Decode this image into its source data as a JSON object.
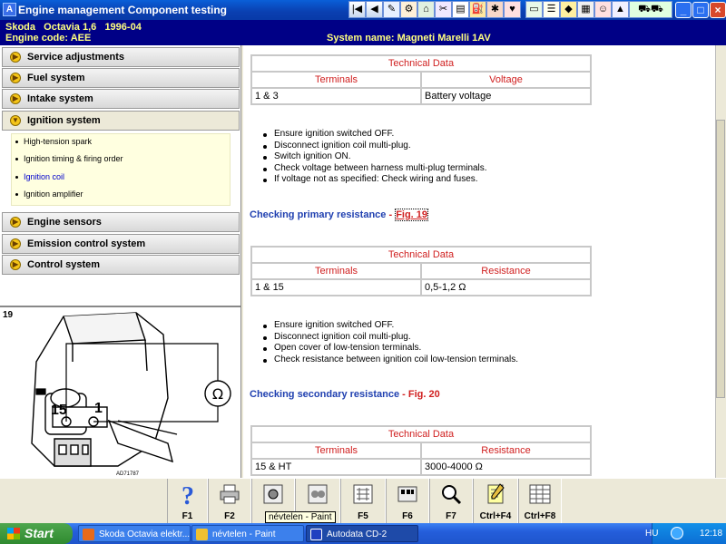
{
  "window": {
    "title": "Engine management Component testing",
    "app_icon_glyph": "A",
    "toolbar_icons": [
      "first-page-icon",
      "previous-icon",
      "bookmark-icon",
      "search-icon",
      "home-icon",
      "tools-icon",
      "manual-icon",
      "fuel-icon",
      "settings-icon",
      "print-icon",
      "warning-icon",
      "help-icon",
      "vehicle-icon",
      "document-icon",
      "user-icon",
      "car-icon"
    ],
    "controls": {
      "minimize": "_",
      "maximize": "□",
      "close": "×"
    }
  },
  "header": {
    "vehicle": "Skoda   Octavia 1,6   1996-04",
    "engine_code": "Engine code: AEE",
    "system_name": "System name: Magneti Marelli 1AV"
  },
  "menu": {
    "items": [
      {
        "label": "Service adjustments"
      },
      {
        "label": "Fuel system"
      },
      {
        "label": "Intake system"
      },
      {
        "label": "Ignition system"
      },
      {
        "label": "Engine sensors"
      },
      {
        "label": "Emission control system"
      },
      {
        "label": "Control system"
      }
    ],
    "subitems": [
      {
        "label": "High-tension spark"
      },
      {
        "label": "Ignition timing & firing order"
      },
      {
        "label": "Ignition coil",
        "active": true
      },
      {
        "label": "Ignition amplifier"
      }
    ]
  },
  "figure": {
    "number": "19",
    "label_left": "15",
    "label_right": "1",
    "code": "AD71787",
    "ohm_symbol": "Ω"
  },
  "content": {
    "table1": {
      "title": "Technical Data",
      "col1": "Terminals",
      "col2": "Voltage",
      "row_col1": "1 & 3",
      "row_col2": "Battery voltage"
    },
    "list1": [
      "Ensure ignition switched OFF.",
      "Disconnect ignition coil multi-plug.",
      "Switch ignition ON.",
      "Check voltage between harness multi-plug terminals.",
      "If voltage not as specified: Check wiring and fuses."
    ],
    "link1": {
      "text": "Checking primary resistance",
      "sep": " - ",
      "fig": "Fig. 19"
    },
    "table2": {
      "title": "Technical Data",
      "col1": "Terminals",
      "col2": "Resistance",
      "row_col1": "1 & 15",
      "row_col2": "0,5-1,2 Ω"
    },
    "list2": [
      "Ensure ignition switched OFF.",
      "Disconnect ignition coil multi-plug.",
      "Open cover of low-tension terminals.",
      "Check resistance between ignition coil low-tension terminals."
    ],
    "link2": {
      "text": "Checking secondary resistance",
      "sep": " - ",
      "fig": "Fig. 20"
    },
    "table3": {
      "title": "Technical Data",
      "col1": "Terminals",
      "col2": "Resistance",
      "row_col1": "15 & HT",
      "row_col2": "3000-4000 Ω"
    }
  },
  "function_keys": [
    {
      "label": "F1",
      "icon": "help-icon"
    },
    {
      "label": "F2",
      "icon": "print-icon"
    },
    {
      "label": "",
      "icon": "component-icon"
    },
    {
      "label": "",
      "icon": "component-test-icon"
    },
    {
      "label": "F5",
      "icon": "wiring-diagram-icon"
    },
    {
      "label": "F6",
      "icon": "connector-icon"
    },
    {
      "label": "F7",
      "icon": "magnifier-icon"
    },
    {
      "label": "Ctrl+F4",
      "icon": "notes-icon"
    },
    {
      "label": "Ctrl+F8",
      "icon": "table-icon"
    }
  ],
  "tooltip": "névtelen - Paint",
  "taskbar": {
    "start": "Start",
    "tasks": [
      {
        "label": "Skoda Octavia elektr..."
      },
      {
        "label": "névtelen - Paint"
      },
      {
        "label": "Autodata CD-2"
      }
    ],
    "lang": "HU",
    "clock": "12:18"
  },
  "colors": {
    "title_bar": "#0a4fc8",
    "header_bg": "#000086",
    "header_text": "#ffff80",
    "table_head": "#d02020",
    "link": "#2040b0",
    "submenu_bg": "#ffffe0"
  }
}
